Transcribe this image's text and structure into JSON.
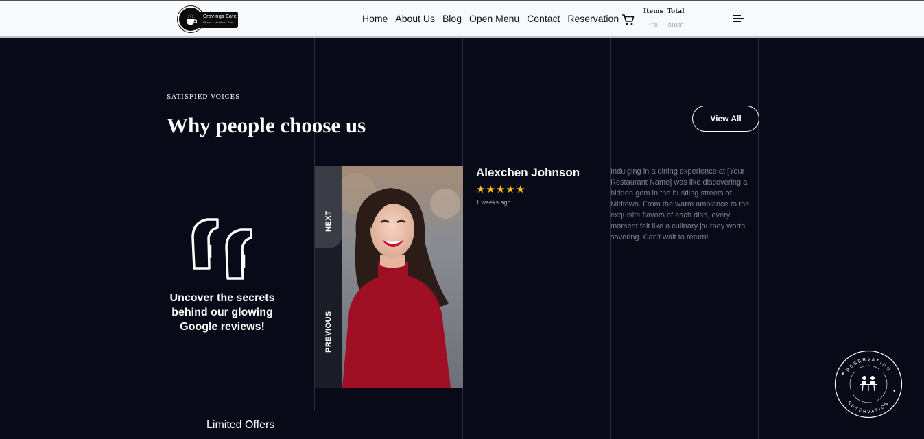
{
  "header": {
    "logo": {
      "name": "Cravings Cafe",
      "tagline": "Dhaba · Healthy · Fine"
    },
    "nav": [
      "Home",
      "About Us",
      "Blog",
      "Open Menu",
      "Contact",
      "Reservation"
    ],
    "cart": {
      "items_label": "Items",
      "items_value": "100",
      "total_label": "Total",
      "total_value": "$1000"
    }
  },
  "section": {
    "eyebrow": "SATISFIED VOICES",
    "title": "Why people choose us",
    "view_all": "View All"
  },
  "quote_column": {
    "text": "Uncover the secrets behind our glowing Google reviews!"
  },
  "slider": {
    "next_label": "NEXT",
    "previous_label": "PREVIOUS"
  },
  "review": {
    "name": "Alexchen Johnson",
    "rating": 5,
    "time_ago": "1 weeks ago",
    "text": "Indulging in a dining experience at [Your Restaurant Name] was like discovering a hidden gem in the bustling streets of Midtown. From the warm ambiance to the exquisite flavors of each dish, every moment felt like a culinary journey worth savoring. Can't wait to return!"
  },
  "footer_teaser": {
    "limited_offers": "Limited Offers"
  },
  "reservation_badge": {
    "text": "RESERVATION"
  },
  "colors": {
    "background": "#080a17",
    "header": "#f8f9fc",
    "star": "#ffc51a",
    "dress": "#9e0f24"
  }
}
